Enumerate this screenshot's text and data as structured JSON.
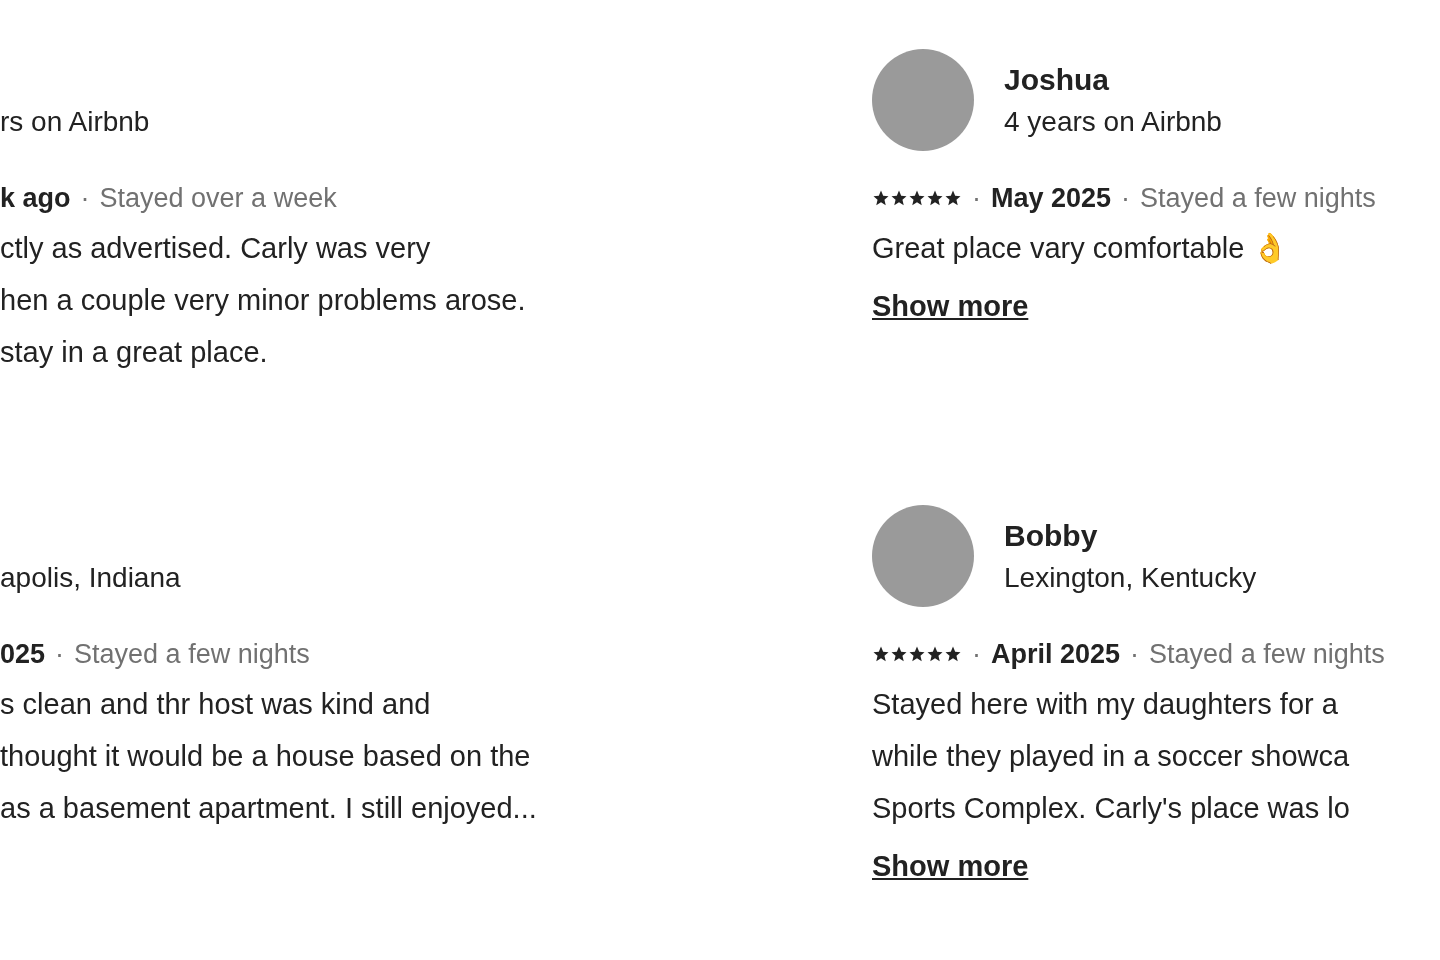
{
  "reviews": [
    {
      "subtitle": "rs on Airbnb",
      "date": "k ago",
      "dot_2": "·",
      "stay": "Stayed over a week",
      "lines": [
        "ctly as advertised. Carly was very",
        "hen a couple very minor problems arose.",
        "stay in a great place."
      ]
    },
    {
      "name": "Joshua",
      "subtitle": "4 years on Airbnb",
      "stars": 5,
      "dot_1": "·",
      "date": "May 2025",
      "dot_2": "·",
      "stay": "Stayed a few nights",
      "lines": [
        "Great place vary comfortable 👌"
      ],
      "show_more": "Show more"
    },
    {
      "subtitle": "apolis, Indiana",
      "date": "025",
      "dot_2": "·",
      "stay": "Stayed a few nights",
      "lines": [
        "s clean and thr host was kind and",
        "thought it would be a house based on the",
        "as a basement apartment. I still enjoyed..."
      ]
    },
    {
      "name": "Bobby",
      "subtitle": "Lexington, Kentucky",
      "stars": 5,
      "dot_1": "·",
      "date": "April 2025",
      "dot_2": "·",
      "stay": "Stayed a few nights",
      "lines": [
        "Stayed here with my daughters for a",
        "while they played in a soccer showca",
        "Sports Complex. Carly's place was lo"
      ],
      "show_more": "Show more"
    }
  ]
}
